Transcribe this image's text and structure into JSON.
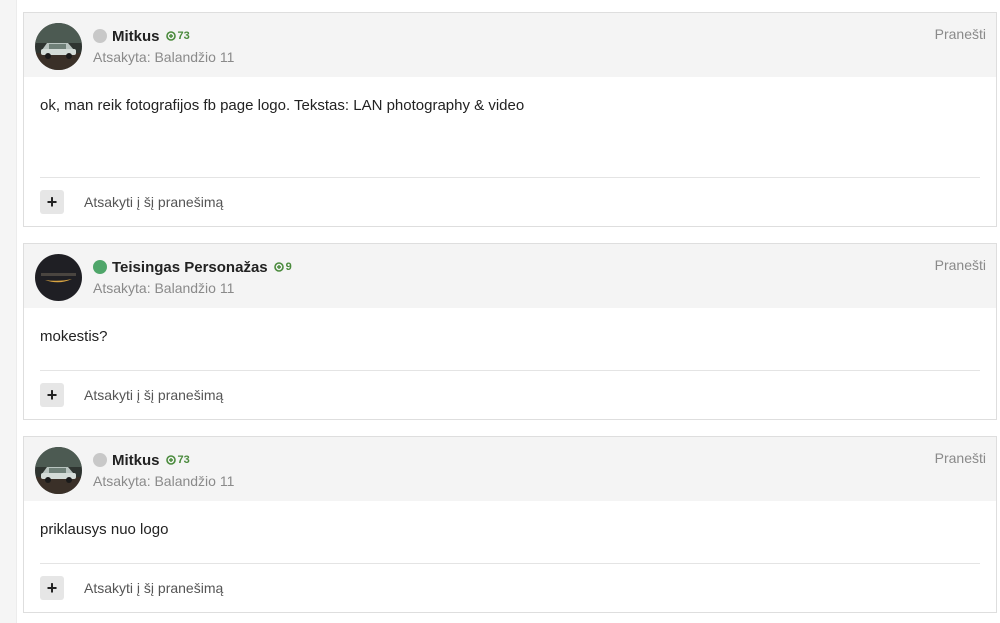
{
  "posts": [
    {
      "author": "Mitkus",
      "status": "offline",
      "status_color": "#c8c8c8",
      "reputation": "73",
      "date": "Atsakyta: Balandžio 11",
      "report_label": "Pranešti",
      "content": "ok, man reik fotografijos fb page logo. Tekstas: LAN photography & video",
      "reply_label": "Atsakyti į šį pranešimą"
    },
    {
      "author": "Teisingas Personažas",
      "status": "online",
      "status_color": "#4fa66a",
      "reputation": "9",
      "date": "Atsakyta: Balandžio 11",
      "report_label": "Pranešti",
      "content": "mokestis?",
      "reply_label": "Atsakyti į šį pranešimą"
    },
    {
      "author": "Mitkus",
      "status": "offline",
      "status_color": "#c8c8c8",
      "reputation": "73",
      "date": "Atsakyta: Balandžio 11",
      "report_label": "Pranešti",
      "content": "priklausys nuo logo",
      "reply_label": "Atsakyti į šį pranešimą"
    }
  ],
  "icons": {
    "reputation": "plus-circle-icon",
    "add": "plus-icon"
  },
  "colors": {
    "reputation_green": "#4a8a3c",
    "header_bg": "#f4f4f4"
  }
}
